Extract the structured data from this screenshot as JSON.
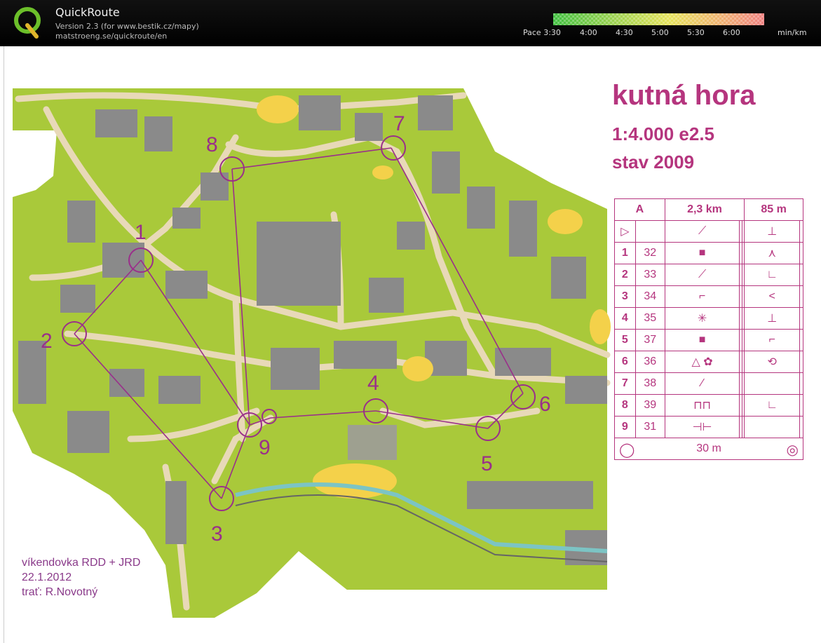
{
  "app": {
    "name": "QuickRoute",
    "version": "Version 2.3  (for www.bestik.cz/mapy)",
    "url": "matstroeng.se/quickroute/en"
  },
  "pace_legend": {
    "labels": [
      "Pace 3:30",
      "4:00",
      "4:30",
      "5:00",
      "5:30",
      "6:00"
    ],
    "unit": "min/km",
    "colors": [
      "#3fbf3f",
      "#9fd34f",
      "#e6e35a",
      "#f0b070",
      "#f08080"
    ]
  },
  "map": {
    "title": "kutná hora",
    "scale": "1:4.000  e2.5",
    "status": "stav 2009",
    "event_lines": [
      "víkendovka RDD + JRD",
      "22.1.2012",
      "trať: R.Novotný"
    ],
    "colors": {
      "course": "#b5357e",
      "green": "#a9c93a",
      "building": "#8a8a8a",
      "road": "#e8d9b8",
      "open": "#f4d14a"
    }
  },
  "controls": [
    {
      "number": "1"
    },
    {
      "number": "2"
    },
    {
      "number": "3"
    },
    {
      "number": "4"
    },
    {
      "number": "5"
    },
    {
      "number": "6"
    },
    {
      "number": "7"
    },
    {
      "number": "8"
    },
    {
      "number": "9"
    }
  ],
  "descriptions": {
    "header": [
      "A",
      "2,3 km",
      "85 m"
    ],
    "rows": [
      {
        "n": "",
        "code": "",
        "symbol": "▷",
        "feature": "⟋",
        "dir": "⊥"
      },
      {
        "n": "1",
        "code": "32",
        "symbol": "",
        "feature": "■",
        "dir": "⋏"
      },
      {
        "n": "2",
        "code": "33",
        "symbol": "",
        "feature": "⟋",
        "dir": "∟"
      },
      {
        "n": "3",
        "code": "34",
        "symbol": "",
        "feature": "⌐",
        "dir": "<"
      },
      {
        "n": "4",
        "code": "35",
        "symbol": "",
        "feature": "✳",
        "dir": "⊥"
      },
      {
        "n": "5",
        "code": "37",
        "symbol": "",
        "feature": "■",
        "dir": "⌐"
      },
      {
        "n": "6",
        "code": "36",
        "symbol": "",
        "feature": "△ ✿",
        "dir": "⟲"
      },
      {
        "n": "7",
        "code": "38",
        "symbol": "",
        "feature": "⁄",
        "dir": ""
      },
      {
        "n": "8",
        "code": "39",
        "symbol": "",
        "feature": "⊓⊓",
        "dir": "∟"
      },
      {
        "n": "9",
        "code": "31",
        "symbol": "",
        "feature": "⊣⊢",
        "dir": ""
      }
    ],
    "finish": "30 m"
  }
}
